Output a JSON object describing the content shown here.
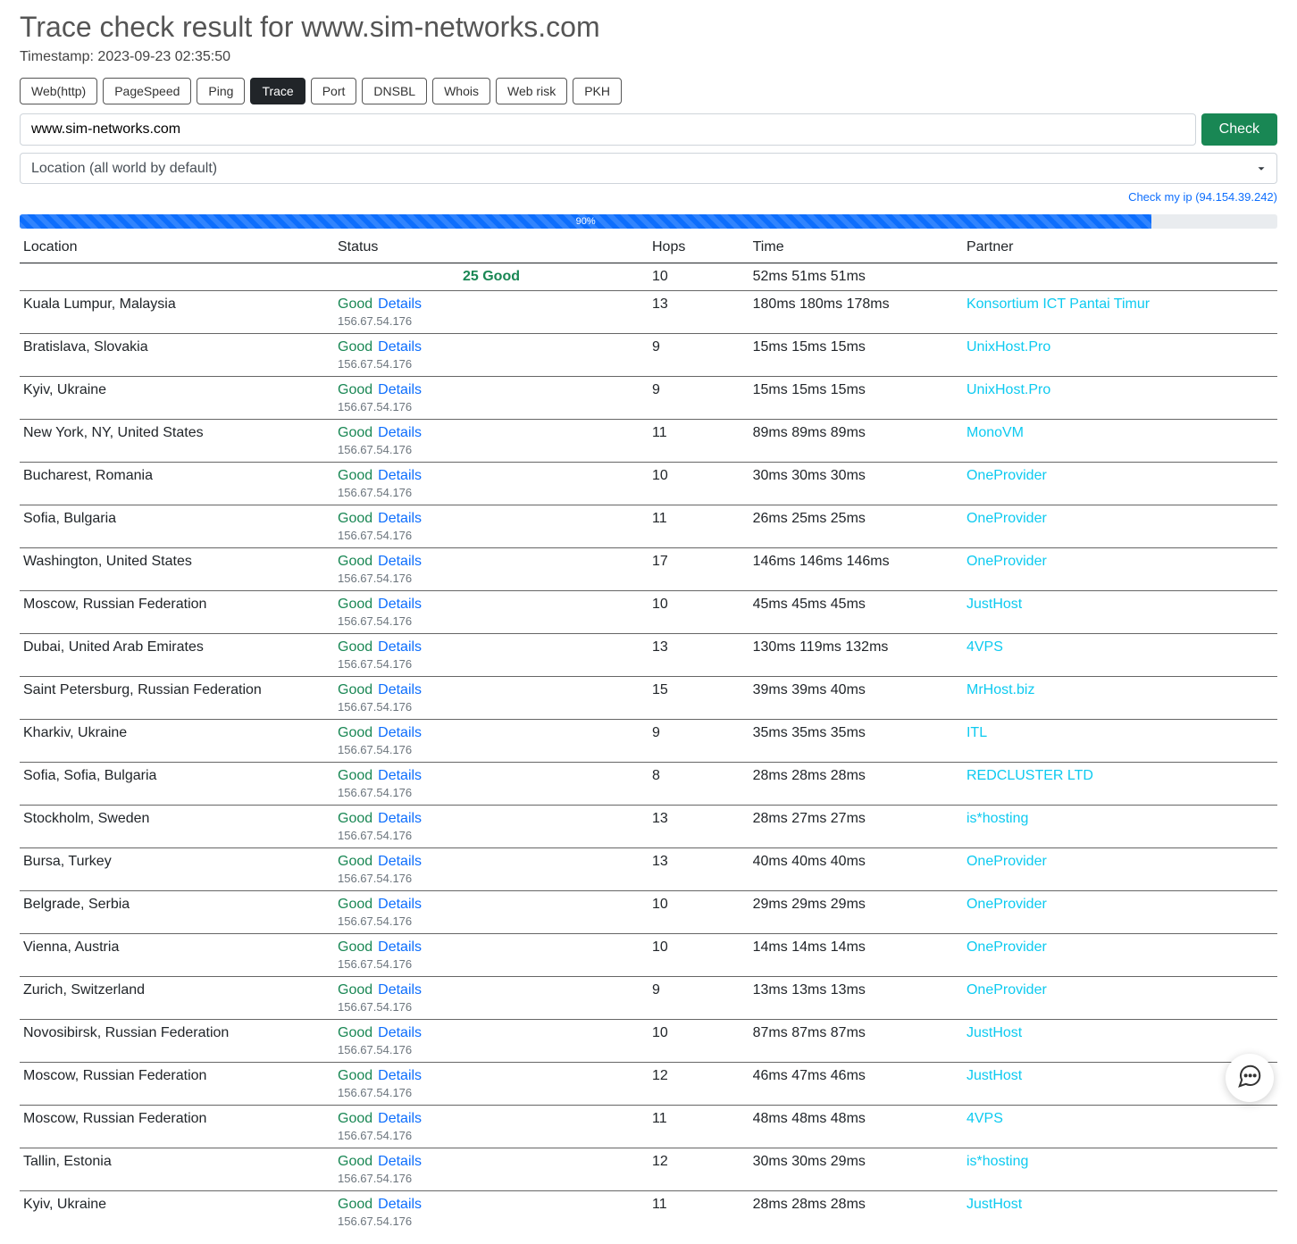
{
  "heading": "Trace check result for www.sim-networks.com",
  "timestamp": "Timestamp: 2023-09-23 02:35:50",
  "tabs": [
    "Web(http)",
    "PageSpeed",
    "Ping",
    "Trace",
    "Port",
    "DNSBL",
    "Whois",
    "Web risk",
    "PKH"
  ],
  "active_tab": "Trace",
  "url_value": "www.sim-networks.com",
  "check_label": "Check",
  "location_placeholder": "Location (all world by default)",
  "check_my_ip": "Check my ip (94.154.39.242)",
  "progress": "90%",
  "columns": {
    "location": "Location",
    "status": "Status",
    "hops": "Hops",
    "time": "Time",
    "partner": "Partner"
  },
  "summary": {
    "count_status": "25 Good",
    "hops": "10",
    "time": "52ms  51ms  51ms"
  },
  "status_label": "Good",
  "details_label": "Details",
  "resolved_ip": "156.67.54.176",
  "rows": [
    {
      "location": "Kuala Lumpur, Malaysia",
      "hops": "13",
      "time": "180ms  180ms  178ms",
      "partner": "Konsortium ICT Pantai Timur"
    },
    {
      "location": "Bratislava, Slovakia",
      "hops": "9",
      "time": "15ms  15ms  15ms",
      "partner": "UnixHost.Pro"
    },
    {
      "location": "Kyiv, Ukraine",
      "hops": "9",
      "time": "15ms  15ms  15ms",
      "partner": "UnixHost.Pro"
    },
    {
      "location": "New York, NY, United States",
      "hops": "11",
      "time": "89ms  89ms  89ms",
      "partner": "MonoVM"
    },
    {
      "location": "Bucharest, Romania",
      "hops": "10",
      "time": "30ms  30ms  30ms",
      "partner": "OneProvider"
    },
    {
      "location": "Sofia, Bulgaria",
      "hops": "11",
      "time": "26ms  25ms  25ms",
      "partner": "OneProvider"
    },
    {
      "location": "Washington, United States",
      "hops": "17",
      "time": "146ms  146ms  146ms",
      "partner": "OneProvider"
    },
    {
      "location": "Moscow, Russian Federation",
      "hops": "10",
      "time": "45ms  45ms  45ms",
      "partner": "JustHost"
    },
    {
      "location": "Dubai, United Arab Emirates",
      "hops": "13",
      "time": "130ms  119ms  132ms",
      "partner": "4VPS"
    },
    {
      "location": "Saint Petersburg, Russian Federation",
      "hops": "15",
      "time": "39ms  39ms  40ms",
      "partner": "MrHost.biz"
    },
    {
      "location": "Kharkiv, Ukraine",
      "hops": "9",
      "time": "35ms  35ms  35ms",
      "partner": "ITL"
    },
    {
      "location": "Sofia, Sofia, Bulgaria",
      "hops": "8",
      "time": "28ms  28ms  28ms",
      "partner": "REDCLUSTER LTD"
    },
    {
      "location": "Stockholm, Sweden",
      "hops": "13",
      "time": "28ms  27ms  27ms",
      "partner": "is*hosting"
    },
    {
      "location": "Bursa, Turkey",
      "hops": "13",
      "time": "40ms  40ms  40ms",
      "partner": "OneProvider"
    },
    {
      "location": "Belgrade, Serbia",
      "hops": "10",
      "time": "29ms  29ms  29ms",
      "partner": "OneProvider"
    },
    {
      "location": "Vienna, Austria",
      "hops": "10",
      "time": "14ms  14ms  14ms",
      "partner": "OneProvider"
    },
    {
      "location": "Zurich, Switzerland",
      "hops": "9",
      "time": "13ms  13ms  13ms",
      "partner": "OneProvider"
    },
    {
      "location": "Novosibirsk, Russian Federation",
      "hops": "10",
      "time": "87ms  87ms  87ms",
      "partner": "JustHost"
    },
    {
      "location": "Moscow, Russian Federation",
      "hops": "12",
      "time": "46ms  47ms  46ms",
      "partner": "JustHost"
    },
    {
      "location": "Moscow, Russian Federation",
      "hops": "11",
      "time": "48ms  48ms  48ms",
      "partner": "4VPS"
    },
    {
      "location": "Tallin, Estonia",
      "hops": "12",
      "time": "30ms  30ms  29ms",
      "partner": "is*hosting"
    },
    {
      "location": "Kyiv, Ukraine",
      "hops": "11",
      "time": "28ms  28ms  28ms",
      "partner": "JustHost"
    }
  ]
}
